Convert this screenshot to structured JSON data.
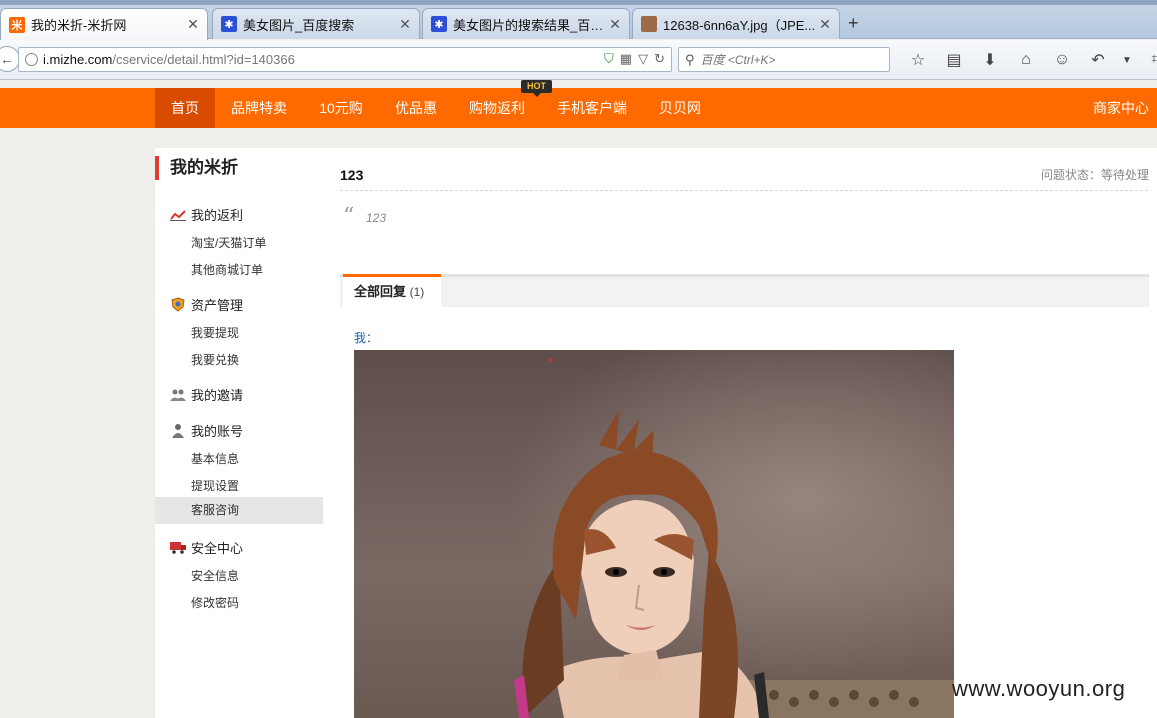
{
  "browser": {
    "tabs": [
      {
        "title": "我的米折-米折网",
        "favicon": "mizhe-icon",
        "color": "#ff6a00",
        "active": true
      },
      {
        "title": "美女图片_百度搜索",
        "favicon": "baidu-paw-icon",
        "color": "#2d4fd6",
        "active": false
      },
      {
        "title": "美女图片的搜索结果_百度...",
        "favicon": "baidu-paw-icon",
        "color": "#2d4fd6",
        "active": false
      },
      {
        "title": "12638-6nn6aY.jpg（JPE...",
        "favicon": "image-icon",
        "color": "#9b6b4a",
        "active": false
      }
    ],
    "url_domain": "i.mizhe.com",
    "url_path": "/cservice/detail.html?id=140366",
    "search_placeholder": "百度 <Ctrl+K>"
  },
  "site_nav": {
    "items": [
      "首页",
      "品牌特卖",
      "10元购",
      "优品惠",
      "购物返利",
      "手机客户端",
      "贝贝网"
    ],
    "hot_badge": "HOT",
    "merchant": "商家中心",
    "accent": "#ff6a00"
  },
  "sidebar": {
    "title": "我的米折",
    "sections": [
      {
        "label": "我的返利",
        "icon": "chart-icon",
        "items": [
          "淘宝/天猫订单",
          "其他商城订单"
        ]
      },
      {
        "label": "资产管理",
        "icon": "shield-coin-icon",
        "items": [
          "我要提现",
          "我要兑换"
        ]
      },
      {
        "label": "我的邀请",
        "icon": "people-icon",
        "items": []
      },
      {
        "label": "我的账号",
        "icon": "user-icon",
        "items": [
          "基本信息",
          "提现设置",
          "客服咨询"
        ]
      },
      {
        "label": "安全中心",
        "icon": "truck-icon",
        "items": [
          "安全信息",
          "修改密码"
        ]
      }
    ],
    "active_item": "客服咨询"
  },
  "question": {
    "title": "123",
    "status": "问题状态：等待处理",
    "body": "123"
  },
  "replies": {
    "tab_label": "全部回复",
    "count": "(1)",
    "author": "我："
  },
  "watermark": "www.wooyun.org"
}
